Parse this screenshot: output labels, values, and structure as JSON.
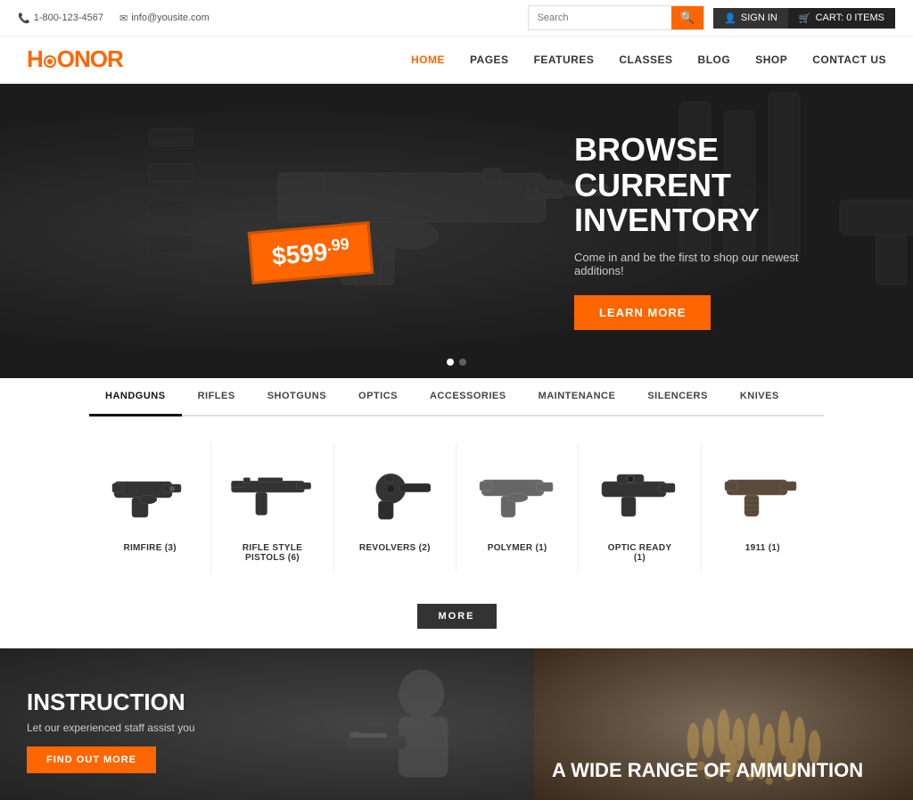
{
  "topbar": {
    "phone": "1-800-123-4567",
    "email": "info@yousite.com",
    "search_placeholder": "Search",
    "search_icon": "🔍",
    "signin_label": "SIGN IN",
    "cart_label": "CART: 0 ITEMS"
  },
  "logo": {
    "text_before": "H",
    "text_middle": "N",
    "text_after": "R",
    "brand": "HONOR"
  },
  "nav": {
    "items": [
      {
        "label": "HOME",
        "active": true
      },
      {
        "label": "PAGES",
        "active": false
      },
      {
        "label": "FEATURES",
        "active": false
      },
      {
        "label": "CLASSES",
        "active": false
      },
      {
        "label": "BLOG",
        "active": false
      },
      {
        "label": "SHOP",
        "active": false
      },
      {
        "label": "CONTACT US",
        "active": false
      }
    ]
  },
  "hero": {
    "price": "$599",
    "price_cents": "99",
    "heading_line1": "BROWSE CURRENT",
    "heading_line2": "INVENTORY",
    "subtext": "Come in and be the first to shop our newest additions!",
    "cta_label": "LEARN MORE"
  },
  "categories": {
    "tabs": [
      {
        "label": "HANDGUNS",
        "active": true
      },
      {
        "label": "RIFLES",
        "active": false
      },
      {
        "label": "SHOTGUNS",
        "active": false
      },
      {
        "label": "OPTICS",
        "active": false
      },
      {
        "label": "ACCESSORIES",
        "active": false
      },
      {
        "label": "MAINTENANCE",
        "active": false
      },
      {
        "label": "SILENCERS",
        "active": false
      },
      {
        "label": "KNIVES",
        "active": false
      }
    ]
  },
  "products": [
    {
      "name": "RIMFIRE (3)",
      "color": "#444"
    },
    {
      "name": "RIFLE STYLE PISTOLS (6)",
      "color": "#444"
    },
    {
      "name": "REVOLVERS (2)",
      "color": "#333"
    },
    {
      "name": "POLYMER (1)",
      "color": "#555"
    },
    {
      "name": "OPTIC READY (1)",
      "color": "#444"
    },
    {
      "name": "1911 (1)",
      "color": "#555"
    }
  ],
  "more_btn": "MORE",
  "promo": {
    "left": {
      "heading": "INSTRUCTION",
      "subtext": "Let our experienced staff assist you",
      "btn_label": "FIND OUT MORE"
    },
    "right": {
      "heading": "A WIDE RANGE OF AMMUNITION"
    }
  }
}
